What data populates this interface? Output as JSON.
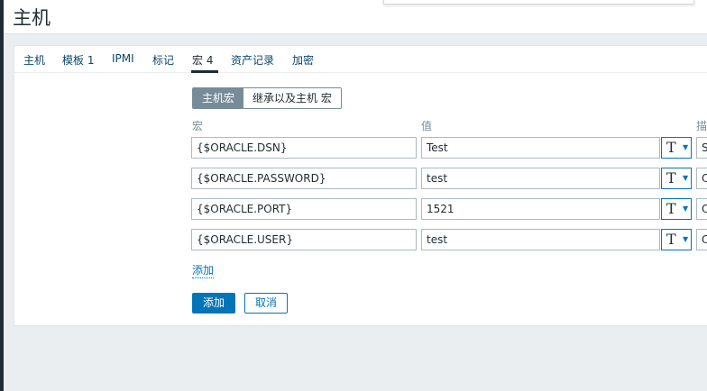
{
  "header": {
    "title": "主机"
  },
  "tabs": [
    {
      "label": "主机"
    },
    {
      "label": "模板 1"
    },
    {
      "label": "IPMI"
    },
    {
      "label": "标记"
    },
    {
      "label": "宏 4"
    },
    {
      "label": "资产记录"
    },
    {
      "label": "加密"
    }
  ],
  "macro_scope": {
    "host_macros": "主机宏",
    "inherited_macros": "继承以及主机 宏"
  },
  "columns": {
    "macro": "宏",
    "value": "值",
    "description": "描"
  },
  "macros": [
    {
      "macro": "{$ORACLE.DSN}",
      "value": "Test",
      "description": "S"
    },
    {
      "macro": "{$ORACLE.PASSWORD}",
      "value": "test",
      "description": "O"
    },
    {
      "macro": "{$ORACLE.PORT}",
      "value": "1521",
      "description": "O"
    },
    {
      "macro": "{$ORACLE.USER}",
      "value": "test",
      "description": "O"
    }
  ],
  "value_type_icon": "T",
  "add_link": "添加",
  "buttons": {
    "submit": "添加",
    "cancel": "取消"
  },
  "colors": {
    "primary": "#0275b8",
    "segment_active": "#768d99"
  }
}
